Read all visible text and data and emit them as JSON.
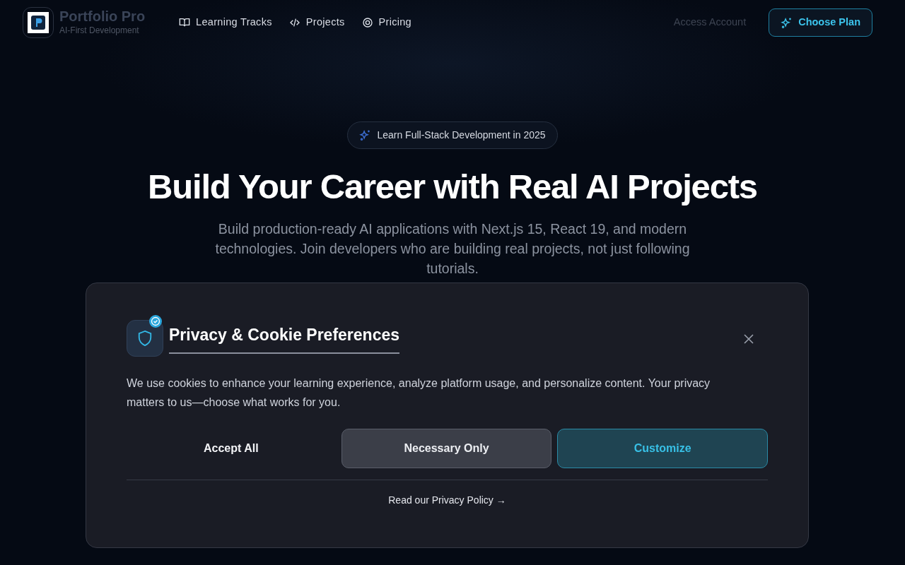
{
  "brand": {
    "name": "Portfolio Pro",
    "tagline": "AI-First Development"
  },
  "nav": [
    {
      "label": "Learning Tracks",
      "kind": "book"
    },
    {
      "label": "Projects",
      "kind": "code"
    },
    {
      "label": "Pricing",
      "kind": "ring"
    }
  ],
  "account_link": "Access Account",
  "cta_button": "Choose Plan",
  "hero": {
    "badge": "Learn Full-Stack Development in 2025",
    "title": "Build Your Career with Real AI Projects",
    "subtitle": "Build production-ready AI applications with Next.js 15, React 19, and modern technologies. Join developers who are building real projects, not just following tutorials."
  },
  "cookie_dialog": {
    "title": "Privacy & Cookie Preferences",
    "message": "We use cookies to enhance your learning experience, analyze platform usage, and personalize content. Your privacy matters to us—choose what works for you.",
    "buttons": [
      {
        "label": "Accept All",
        "kind": "ghost"
      },
      {
        "label": "Necessary Only",
        "kind": "secondary"
      },
      {
        "label": "Customize",
        "kind": "primary"
      }
    ],
    "policy_link": "Read our Privacy Policy →"
  }
}
